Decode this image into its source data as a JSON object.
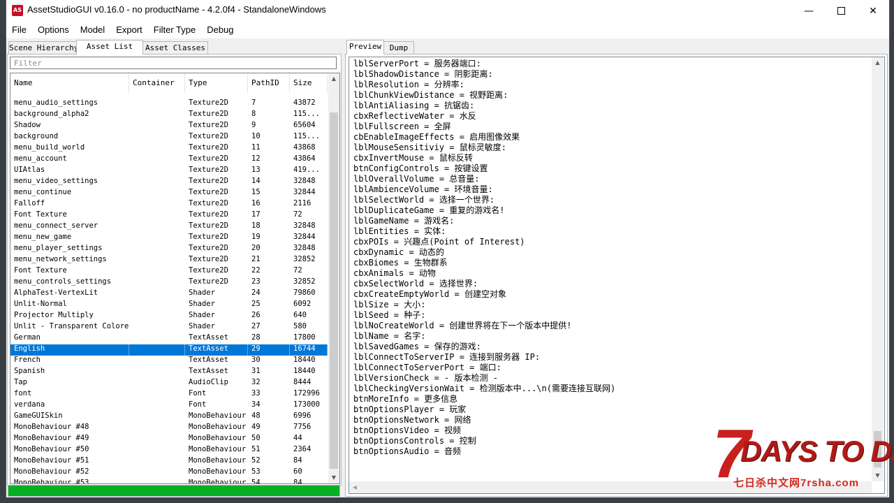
{
  "window": {
    "title": "AssetStudioGUI v0.16.0 - no productName - 4.2.0f4 - StandaloneWindows",
    "app_icon_text": "AS",
    "minimize": "—",
    "close": "✕"
  },
  "menu": [
    "File",
    "Options",
    "Model",
    "Export",
    "Filter Type",
    "Debug"
  ],
  "left_tabs": [
    "Scene Hierarchy",
    "Asset List",
    "Asset Classes"
  ],
  "filter_placeholder": "Filter",
  "columns": [
    "Name",
    "Container",
    "Type",
    "PathID",
    "Size"
  ],
  "assets": [
    {
      "name": "menu_audio_settings",
      "container": "",
      "type": "Texture2D",
      "path_id": "7",
      "size": "43872"
    },
    {
      "name": "background_alpha2",
      "container": "",
      "type": "Texture2D",
      "path_id": "8",
      "size": "115..."
    },
    {
      "name": "Shadow",
      "container": "",
      "type": "Texture2D",
      "path_id": "9",
      "size": "65604"
    },
    {
      "name": "background",
      "container": "",
      "type": "Texture2D",
      "path_id": "10",
      "size": "115..."
    },
    {
      "name": "menu_build_world",
      "container": "",
      "type": "Texture2D",
      "path_id": "11",
      "size": "43868"
    },
    {
      "name": "menu_account",
      "container": "",
      "type": "Texture2D",
      "path_id": "12",
      "size": "43864"
    },
    {
      "name": "UIAtlas",
      "container": "",
      "type": "Texture2D",
      "path_id": "13",
      "size": "419..."
    },
    {
      "name": "menu_video_settings",
      "container": "",
      "type": "Texture2D",
      "path_id": "14",
      "size": "32848"
    },
    {
      "name": "menu_continue",
      "container": "",
      "type": "Texture2D",
      "path_id": "15",
      "size": "32844"
    },
    {
      "name": "Falloff",
      "container": "",
      "type": "Texture2D",
      "path_id": "16",
      "size": "2116"
    },
    {
      "name": "Font Texture",
      "container": "",
      "type": "Texture2D",
      "path_id": "17",
      "size": "72"
    },
    {
      "name": "menu_connect_server",
      "container": "",
      "type": "Texture2D",
      "path_id": "18",
      "size": "32848"
    },
    {
      "name": "menu_new_game",
      "container": "",
      "type": "Texture2D",
      "path_id": "19",
      "size": "32844"
    },
    {
      "name": "menu_player_settings",
      "container": "",
      "type": "Texture2D",
      "path_id": "20",
      "size": "32848"
    },
    {
      "name": "menu_network_settings",
      "container": "",
      "type": "Texture2D",
      "path_id": "21",
      "size": "32852"
    },
    {
      "name": "Font Texture",
      "container": "",
      "type": "Texture2D",
      "path_id": "22",
      "size": "72"
    },
    {
      "name": "menu_controls_settings",
      "container": "",
      "type": "Texture2D",
      "path_id": "23",
      "size": "32852"
    },
    {
      "name": "AlphaTest-VertexLit",
      "container": "",
      "type": "Shader",
      "path_id": "24",
      "size": "79860"
    },
    {
      "name": "Unlit-Normal",
      "container": "",
      "type": "Shader",
      "path_id": "25",
      "size": "6092"
    },
    {
      "name": "Projector Multiply",
      "container": "",
      "type": "Shader",
      "path_id": "26",
      "size": "640"
    },
    {
      "name": "Unlit - Transparent Colored",
      "container": "",
      "type": "Shader",
      "path_id": "27",
      "size": "580"
    },
    {
      "name": "German",
      "container": "",
      "type": "TextAsset",
      "path_id": "28",
      "size": "17800"
    },
    {
      "name": "English",
      "container": "",
      "type": "TextAsset",
      "path_id": "29",
      "size": "16744",
      "selected": true
    },
    {
      "name": "French",
      "container": "",
      "type": "TextAsset",
      "path_id": "30",
      "size": "18440"
    },
    {
      "name": "Spanish",
      "container": "",
      "type": "TextAsset",
      "path_id": "31",
      "size": "18440"
    },
    {
      "name": "Tap",
      "container": "",
      "type": "AudioClip",
      "path_id": "32",
      "size": "8444"
    },
    {
      "name": "font",
      "container": "",
      "type": "Font",
      "path_id": "33",
      "size": "172996"
    },
    {
      "name": "verdana",
      "container": "",
      "type": "Font",
      "path_id": "34",
      "size": "173000"
    },
    {
      "name": "GameGUISkin",
      "container": "",
      "type": "MonoBehaviour",
      "path_id": "48",
      "size": "6996"
    },
    {
      "name": "MonoBehaviour #48",
      "container": "",
      "type": "MonoBehaviour",
      "path_id": "49",
      "size": "7756"
    },
    {
      "name": "MonoBehaviour #49",
      "container": "",
      "type": "MonoBehaviour",
      "path_id": "50",
      "size": "44"
    },
    {
      "name": "MonoBehaviour #50",
      "container": "",
      "type": "MonoBehaviour",
      "path_id": "51",
      "size": "2364"
    },
    {
      "name": "MonoBehaviour #51",
      "container": "",
      "type": "MonoBehaviour",
      "path_id": "52",
      "size": "84"
    },
    {
      "name": "MonoBehaviour #52",
      "container": "",
      "type": "MonoBehaviour",
      "path_id": "53",
      "size": "60"
    },
    {
      "name": "MonoBehaviour #53",
      "container": "",
      "type": "MonoBehaviour",
      "path_id": "54",
      "size": "84"
    }
  ],
  "progress_percent": 100,
  "right_tabs": [
    "Preview",
    "Dump"
  ],
  "preview_lines": [
    "lblServerPort = 服务器端口:",
    "lblShadowDistance = 阴影距离:",
    "lblResolution = 分辨率:",
    "lblChunkViewDistance = 视野距离:",
    "lblAntiAliasing = 抗锯齿:",
    "cbxReflectiveWater = 水反",
    "lblFullscreen = 全屏",
    "cbEnableImageEffects = 启用图像效果",
    "lblMouseSensitiviy = 鼠标灵敏度:",
    "cbxInvertMouse = 鼠标反转",
    "btnConfigControls = 按键设置",
    "lblOverallVolume = 总音量:",
    "lblAmbienceVolume = 环境音量:",
    "lblSelectWorld = 选择一个世界:",
    "lblDuplicateGame = 重复的游戏名!",
    "lblGameName = 游戏名:",
    "lblEntities = 实体:",
    "cbxPOIs = 兴趣点(Point of Interest)",
    "cbxDynamic = 动态的",
    "cbxBiomes = 生物群系",
    "cbxAnimals = 动物",
    "cbxSelectWorld = 选择世界:",
    "cbxCreateEmptyWorld = 创建空对象",
    "lblSize = 大小:",
    "lblSeed = 种子:",
    "lblNoCreateWorld = 创建世界将在下一个版本中提供!",
    "lblName = 名字:",
    "lblSavedGames = 保存的游戏:",
    "lblConnectToServerIP = 连接到服务器 IP:",
    "lblConnectToServerPort = 端口:",
    "lblVersionCheck = - 版本检测 -",
    "lblCheckingVersionWait = 检测版本中...\\n(需要连接互联网)",
    "btnMoreInfo = 更多信息",
    "btnOptionsPlayer = 玩家",
    "btnOptionsNetwork = 网络",
    "btnOptionsVideo = 视频",
    "btnOptionsControls = 控制",
    "btnOptionsAudio = 音频"
  ],
  "watermark": {
    "big_text": "7",
    "text": "DAYS TO DIE",
    "sub_text": "七日杀中文网7rsha.com"
  },
  "colors": {
    "selection": "#0078d7",
    "progress": "#06b025",
    "watermark_red": "#c8201f"
  },
  "icons": {
    "window": "app-icon",
    "minimize": "minimize-icon",
    "maximize": "maximize-icon",
    "close": "close-icon",
    "scroll_up": "chevron-up-icon",
    "scroll_down": "chevron-down-icon",
    "scroll_left": "chevron-left-icon"
  }
}
